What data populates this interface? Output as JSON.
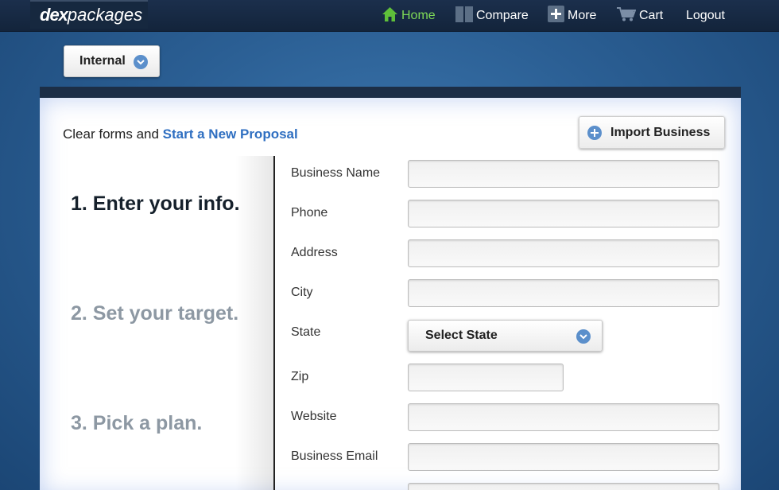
{
  "header": {
    "logo_dex": "dex",
    "logo_packages": "packages",
    "nav": {
      "home": "Home",
      "compare": "Compare",
      "more": "More",
      "cart": "Cart",
      "logout": "Logout"
    }
  },
  "account_selector": {
    "label": "Internal"
  },
  "toolbar": {
    "clear_prefix": "Clear forms and ",
    "new_proposal_link": "Start a New Proposal",
    "import_label": "Import Business"
  },
  "steps": [
    {
      "label": "1. Enter your info."
    },
    {
      "label": "2. Set your target."
    },
    {
      "label": "3. Pick a plan."
    }
  ],
  "form": {
    "business_name": {
      "label": "Business Name",
      "value": ""
    },
    "phone": {
      "label": "Phone",
      "value": ""
    },
    "address": {
      "label": "Address",
      "value": ""
    },
    "city": {
      "label": "City",
      "value": ""
    },
    "state": {
      "label": "State",
      "selected": "Select State"
    },
    "zip": {
      "label": "Zip",
      "value": ""
    },
    "website": {
      "label": "Website",
      "value": ""
    },
    "business_email": {
      "label": "Business Email",
      "value": ""
    }
  },
  "colors": {
    "accent_link": "#2f6fc1",
    "home_active": "#7ed957",
    "nav_bg": "#16283f",
    "step_inactive": "#8d98a3"
  }
}
